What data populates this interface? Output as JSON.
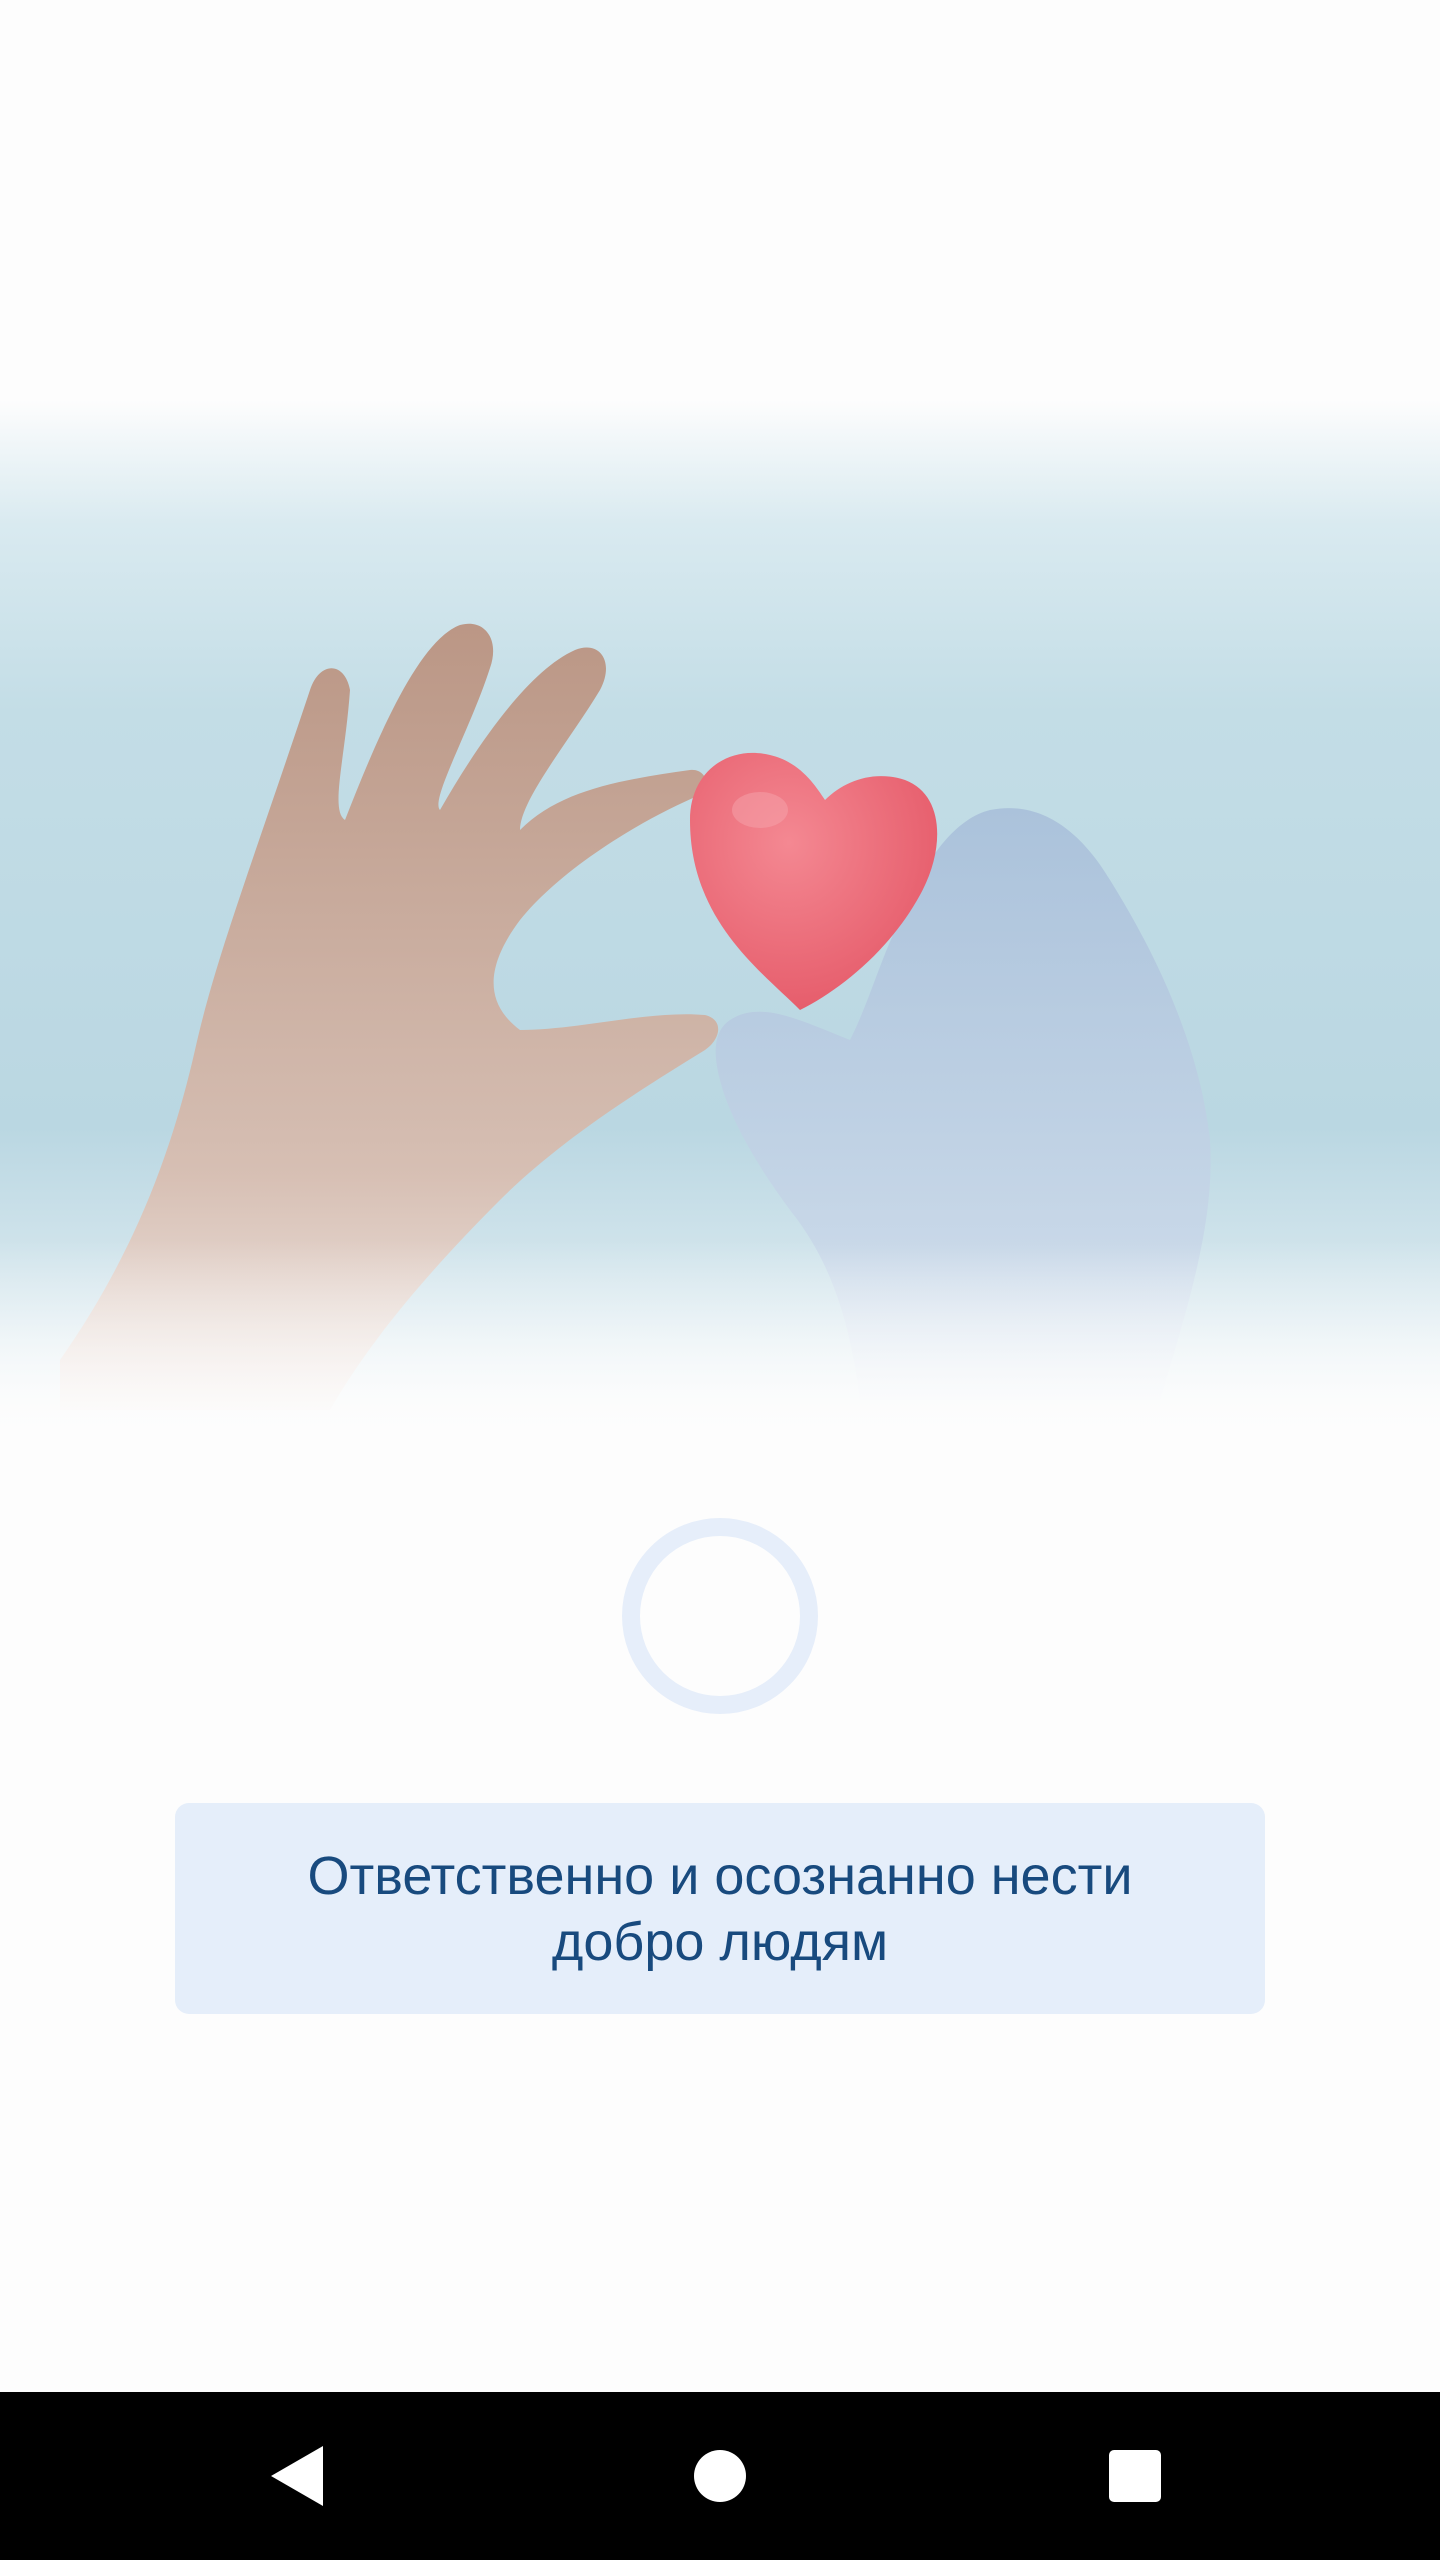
{
  "hero": {
    "icon": "heart-in-hands-image",
    "background_color": "#bcd9e3",
    "heart_color": "#ee6a77",
    "glove_color": "#b7cbe0",
    "hand_color": "#c9a38e"
  },
  "loader": {
    "icon": "loading-ring",
    "color": "#e6eefa"
  },
  "slogan": {
    "text": "Ответственно и осознанно нести добро людям",
    "text_color": "#184a7e",
    "background_color": "#e5eefa"
  },
  "navigation_bar": {
    "back_icon": "back-triangle-icon",
    "home_icon": "home-circle-icon",
    "recents_icon": "recents-square-icon"
  }
}
